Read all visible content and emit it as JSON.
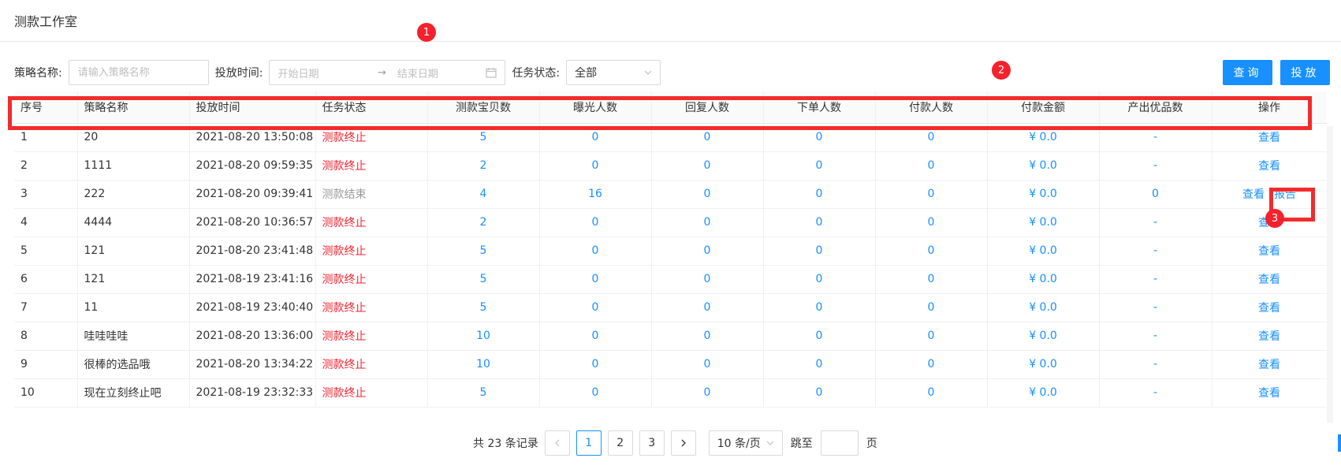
{
  "page": {
    "title": "测款工作室"
  },
  "filters": {
    "strategy_label": "策略名称:",
    "strategy_placeholder": "请输入策略名称",
    "time_label": "投放时间:",
    "start_placeholder": "开始日期",
    "end_placeholder": "结束日期",
    "status_label": "任务状态:",
    "status_value": "全部"
  },
  "buttons": {
    "query": "查询",
    "launch": "投放"
  },
  "badges": {
    "b1": "1",
    "b2": "2",
    "b3": "3"
  },
  "table": {
    "columns": [
      "序号",
      "策略名称",
      "投放时间",
      "任务状态",
      "测款宝贝数",
      "曝光人数",
      "回复人数",
      "下单人数",
      "付款人数",
      "付款金额",
      "产出优品数",
      "操作"
    ],
    "rows": [
      {
        "idx": "1",
        "name": "20",
        "time": "2021-08-20 13:50:08",
        "status": "测款终止",
        "items": "5",
        "exposure": "0",
        "reply": "0",
        "orders": "0",
        "payers": "0",
        "amount": "¥ 0.0",
        "good": "-",
        "ops": [
          "查看"
        ]
      },
      {
        "idx": "2",
        "name": "1111",
        "time": "2021-08-20 09:59:35",
        "status": "测款终止",
        "items": "2",
        "exposure": "0",
        "reply": "0",
        "orders": "0",
        "payers": "0",
        "amount": "¥ 0.0",
        "good": "-",
        "ops": [
          "查看"
        ]
      },
      {
        "idx": "3",
        "name": "222",
        "time": "2021-08-20 09:39:41",
        "status": "测款结束",
        "items": "4",
        "exposure": "16",
        "reply": "0",
        "orders": "0",
        "payers": "0",
        "amount": "¥ 0.0",
        "good": "0",
        "ops": [
          "查看",
          "报告"
        ]
      },
      {
        "idx": "4",
        "name": "4444",
        "time": "2021-08-20 10:36:57",
        "status": "测款终止",
        "items": "2",
        "exposure": "0",
        "reply": "0",
        "orders": "0",
        "payers": "0",
        "amount": "¥ 0.0",
        "good": "-",
        "ops": [
          "查看"
        ]
      },
      {
        "idx": "5",
        "name": "121",
        "time": "2021-08-20 23:41:48",
        "status": "测款终止",
        "items": "5",
        "exposure": "0",
        "reply": "0",
        "orders": "0",
        "payers": "0",
        "amount": "¥ 0.0",
        "good": "-",
        "ops": [
          "查看"
        ]
      },
      {
        "idx": "6",
        "name": "121",
        "time": "2021-08-19 23:41:16",
        "status": "测款终止",
        "items": "5",
        "exposure": "0",
        "reply": "0",
        "orders": "0",
        "payers": "0",
        "amount": "¥ 0.0",
        "good": "-",
        "ops": [
          "查看"
        ]
      },
      {
        "idx": "7",
        "name": "11",
        "time": "2021-08-19 23:40:40",
        "status": "测款终止",
        "items": "5",
        "exposure": "0",
        "reply": "0",
        "orders": "0",
        "payers": "0",
        "amount": "¥ 0.0",
        "good": "-",
        "ops": [
          "查看"
        ]
      },
      {
        "idx": "8",
        "name": "哇哇哇哇",
        "time": "2021-08-20 13:36:00",
        "status": "测款终止",
        "items": "10",
        "exposure": "0",
        "reply": "0",
        "orders": "0",
        "payers": "0",
        "amount": "¥ 0.0",
        "good": "-",
        "ops": [
          "查看"
        ]
      },
      {
        "idx": "9",
        "name": "很棒的选品哦",
        "time": "2021-08-20 13:34:22",
        "status": "测款终止",
        "items": "10",
        "exposure": "0",
        "reply": "0",
        "orders": "0",
        "payers": "0",
        "amount": "¥ 0.0",
        "good": "-",
        "ops": [
          "查看"
        ]
      },
      {
        "idx": "10",
        "name": "现在立刻终止吧",
        "time": "2021-08-19 23:32:33",
        "status": "测款终止",
        "items": "5",
        "exposure": "0",
        "reply": "0",
        "orders": "0",
        "payers": "0",
        "amount": "¥ 0.0",
        "good": "-",
        "ops": [
          "查看"
        ]
      }
    ]
  },
  "pagination": {
    "total": "共 23 条记录",
    "pages": [
      "1",
      "2",
      "3"
    ],
    "current": "1",
    "page_size": "10 条/页",
    "jump_label": "跳至",
    "jump_suffix": "页"
  },
  "colors": {
    "primary": "#1890ff",
    "danger": "#f5222d",
    "muted": "#999999",
    "highlight": "#f22b2b"
  },
  "icons": {
    "calendar": "calendar-icon",
    "chevron": "chevron-down-icon",
    "prev": "chevron-left-icon",
    "next": "chevron-right-icon"
  }
}
